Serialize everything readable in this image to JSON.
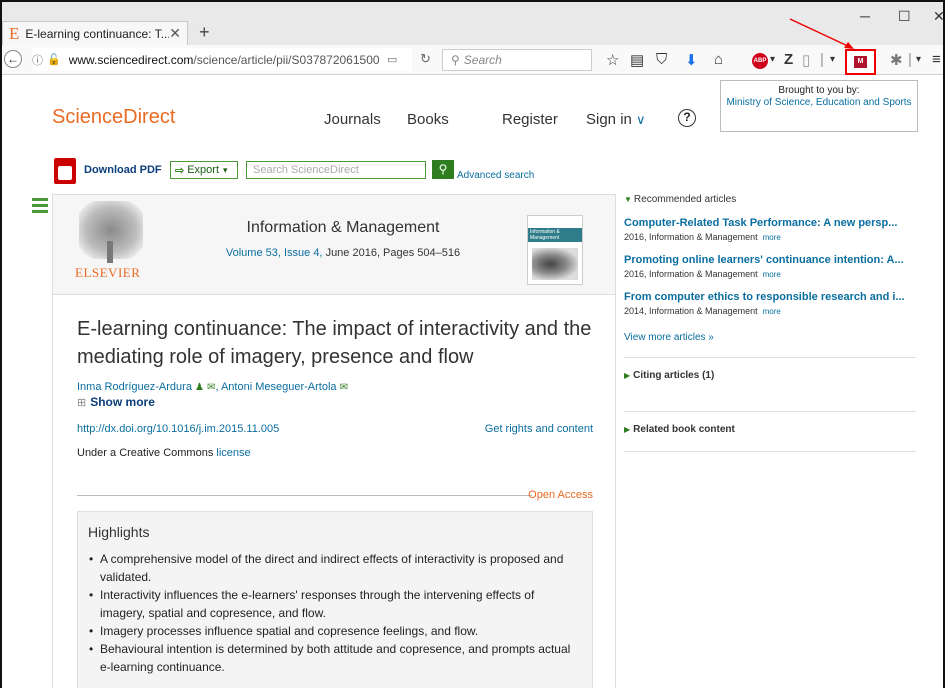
{
  "browser": {
    "tab_title": "E-learning continuance: T...",
    "tab_close": "✕",
    "new_tab": "+",
    "url_host": "www.sciencedirect.com",
    "url_path": "/science/article/pii/S037872061500",
    "search_placeholder": "Search"
  },
  "header": {
    "logo": "ScienceDirect",
    "nav": [
      "Journals",
      "Books",
      "Register",
      "Sign in"
    ],
    "brought_to_you": "Brought to you by:",
    "institution": "Ministry of Science, Education and Sports"
  },
  "toolbar": {
    "download_pdf": "Download PDF",
    "export": "Export",
    "search_placeholder": "Search ScienceDirect",
    "advanced_search": "Advanced search"
  },
  "journal": {
    "publisher": "ELSEVIER",
    "title": "Information & Management",
    "volume_link": "Volume 53, Issue 4,",
    "date_pages": "June 2016, Pages 504–516",
    "cover_text": "Information & Management"
  },
  "article": {
    "title": "E-learning continuance: The impact of interactivity and the mediating role of imagery, presence and flow",
    "author1": "Inma Rodríguez-Ardura",
    "author2": "Antoni Meseguer-Artola",
    "show_more": "Show more",
    "doi": "http://dx.doi.org/10.1016/j.im.2015.11.005",
    "rights": "Get rights and content",
    "license_prefix": "Under a Creative Commons",
    "license_link": "license",
    "open_access": "Open Access"
  },
  "highlights": {
    "heading": "Highlights",
    "items": [
      "A comprehensive model of the direct and indirect effects of interactivity is proposed and validated.",
      "Interactivity influences the e-learners' responses through the intervening effects of imagery, spatial and copresence, and flow.",
      "Imagery processes influence spatial and copresence feelings, and flow.",
      "Behavioural intention is determined by both attitude and copresence, and prompts actual e-learning continuance."
    ]
  },
  "sidebar": {
    "recommended_heading": "Recommended articles",
    "recommended": [
      {
        "title": "Computer-Related Task Performance: A new persp...",
        "meta": "2016, Information & Management",
        "more": "more"
      },
      {
        "title": "Promoting online learners' continuance intention: A...",
        "meta": "2016, Information & Management",
        "more": "more"
      },
      {
        "title": "From computer ethics to responsible research and i...",
        "meta": "2014, Information & Management",
        "more": "more"
      }
    ],
    "view_more": "View more articles »",
    "citing": "Citing articles (1)",
    "related": "Related book content"
  },
  "colors": {
    "brand_orange": "#e96b24",
    "link_blue": "#0a6ea0",
    "accent_green": "#2e7d1e",
    "highlight_red": "#e00000"
  }
}
